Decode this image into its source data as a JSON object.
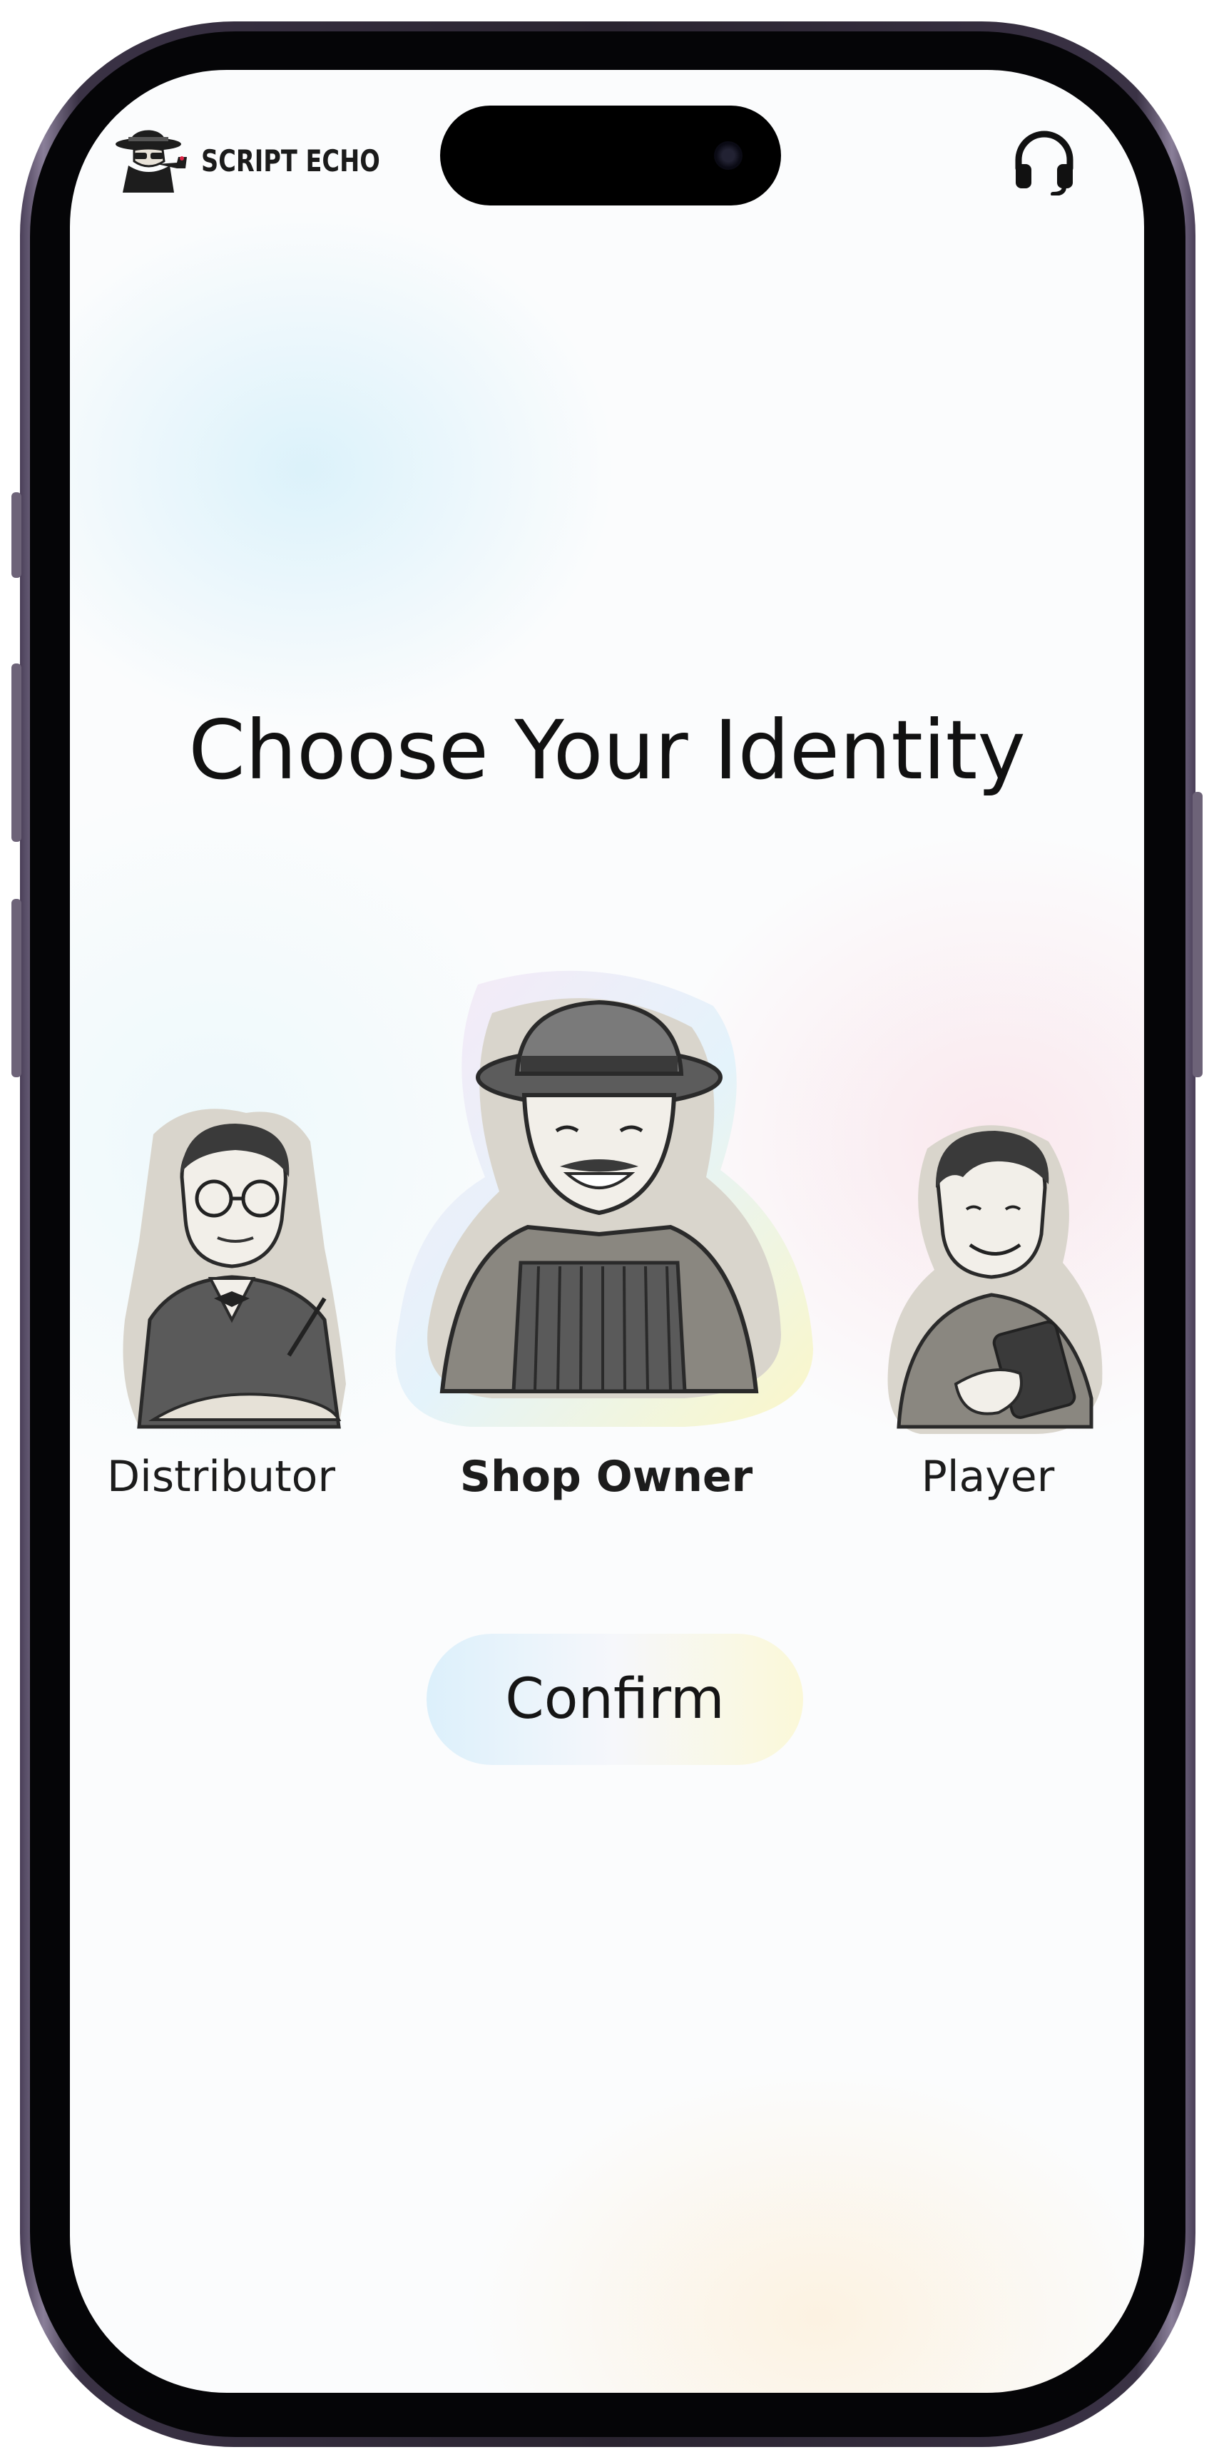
{
  "app": {
    "brand_name": "SCRIPT ECHO",
    "logo_icon": "detective-with-pipe-icon",
    "support_icon": "headphones-icon"
  },
  "page": {
    "title": "Choose Your Identity"
  },
  "identities": [
    {
      "label": "Distributor",
      "selected": false,
      "icon": "distributor-portrait"
    },
    {
      "label": "Shop Owner",
      "selected": true,
      "icon": "shop-owner-portrait"
    },
    {
      "label": "Player",
      "selected": false,
      "icon": "player-portrait"
    }
  ],
  "actions": {
    "confirm_label": "Confirm"
  },
  "colors": {
    "text": "#111111",
    "portrait_bg": "#d9d5cc",
    "confirm_from": "#dcf0fb",
    "confirm_to": "#fbf8d8"
  }
}
